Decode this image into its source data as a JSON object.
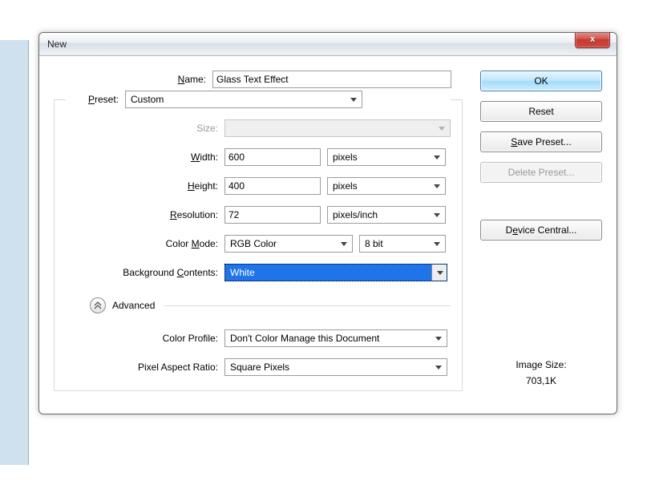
{
  "dialog": {
    "title": "New",
    "close_label": "x"
  },
  "labels": {
    "name": "ame:",
    "name_mn": "N",
    "preset": "reset:",
    "preset_mn": "P",
    "size": "ze:",
    "size_mn": "Si",
    "width": "idth:",
    "width_mn": "W",
    "height": "eight:",
    "height_mn": "H",
    "resolution": "esolution:",
    "resolution_mn": "R",
    "color_mode": "ode:",
    "color_mode_prefix": "Color ",
    "color_mode_mn": "M",
    "bg_contents": "ontents:",
    "bg_contents_prefix": "Background ",
    "bg_contents_mn": "C",
    "advanced": "Advanced",
    "color_profile": "Color Profile:",
    "pixel_aspect": "Pixel Aspect Ratio:"
  },
  "values": {
    "name": "Glass Text Effect",
    "preset": "Custom",
    "size": "",
    "width": "600",
    "width_unit": "pixels",
    "height": "400",
    "height_unit": "pixels",
    "resolution": "72",
    "resolution_unit": "pixels/inch",
    "color_mode": "RGB Color",
    "color_depth": "8 bit",
    "bg_contents": "White",
    "color_profile": "Don't Color Manage this Document",
    "pixel_aspect": "Square Pixels"
  },
  "buttons": {
    "ok": "OK",
    "reset": "Reset",
    "save_preset_mn": "S",
    "save_preset": "ave Preset...",
    "delete_preset_mn": "D",
    "delete_preset": "elete Preset...",
    "device_central_mn": "e",
    "device_central_pre": "D",
    "device_central_post": "vice Central..."
  },
  "info": {
    "image_size_label": "Image Size:",
    "image_size_value": "703,1K"
  }
}
